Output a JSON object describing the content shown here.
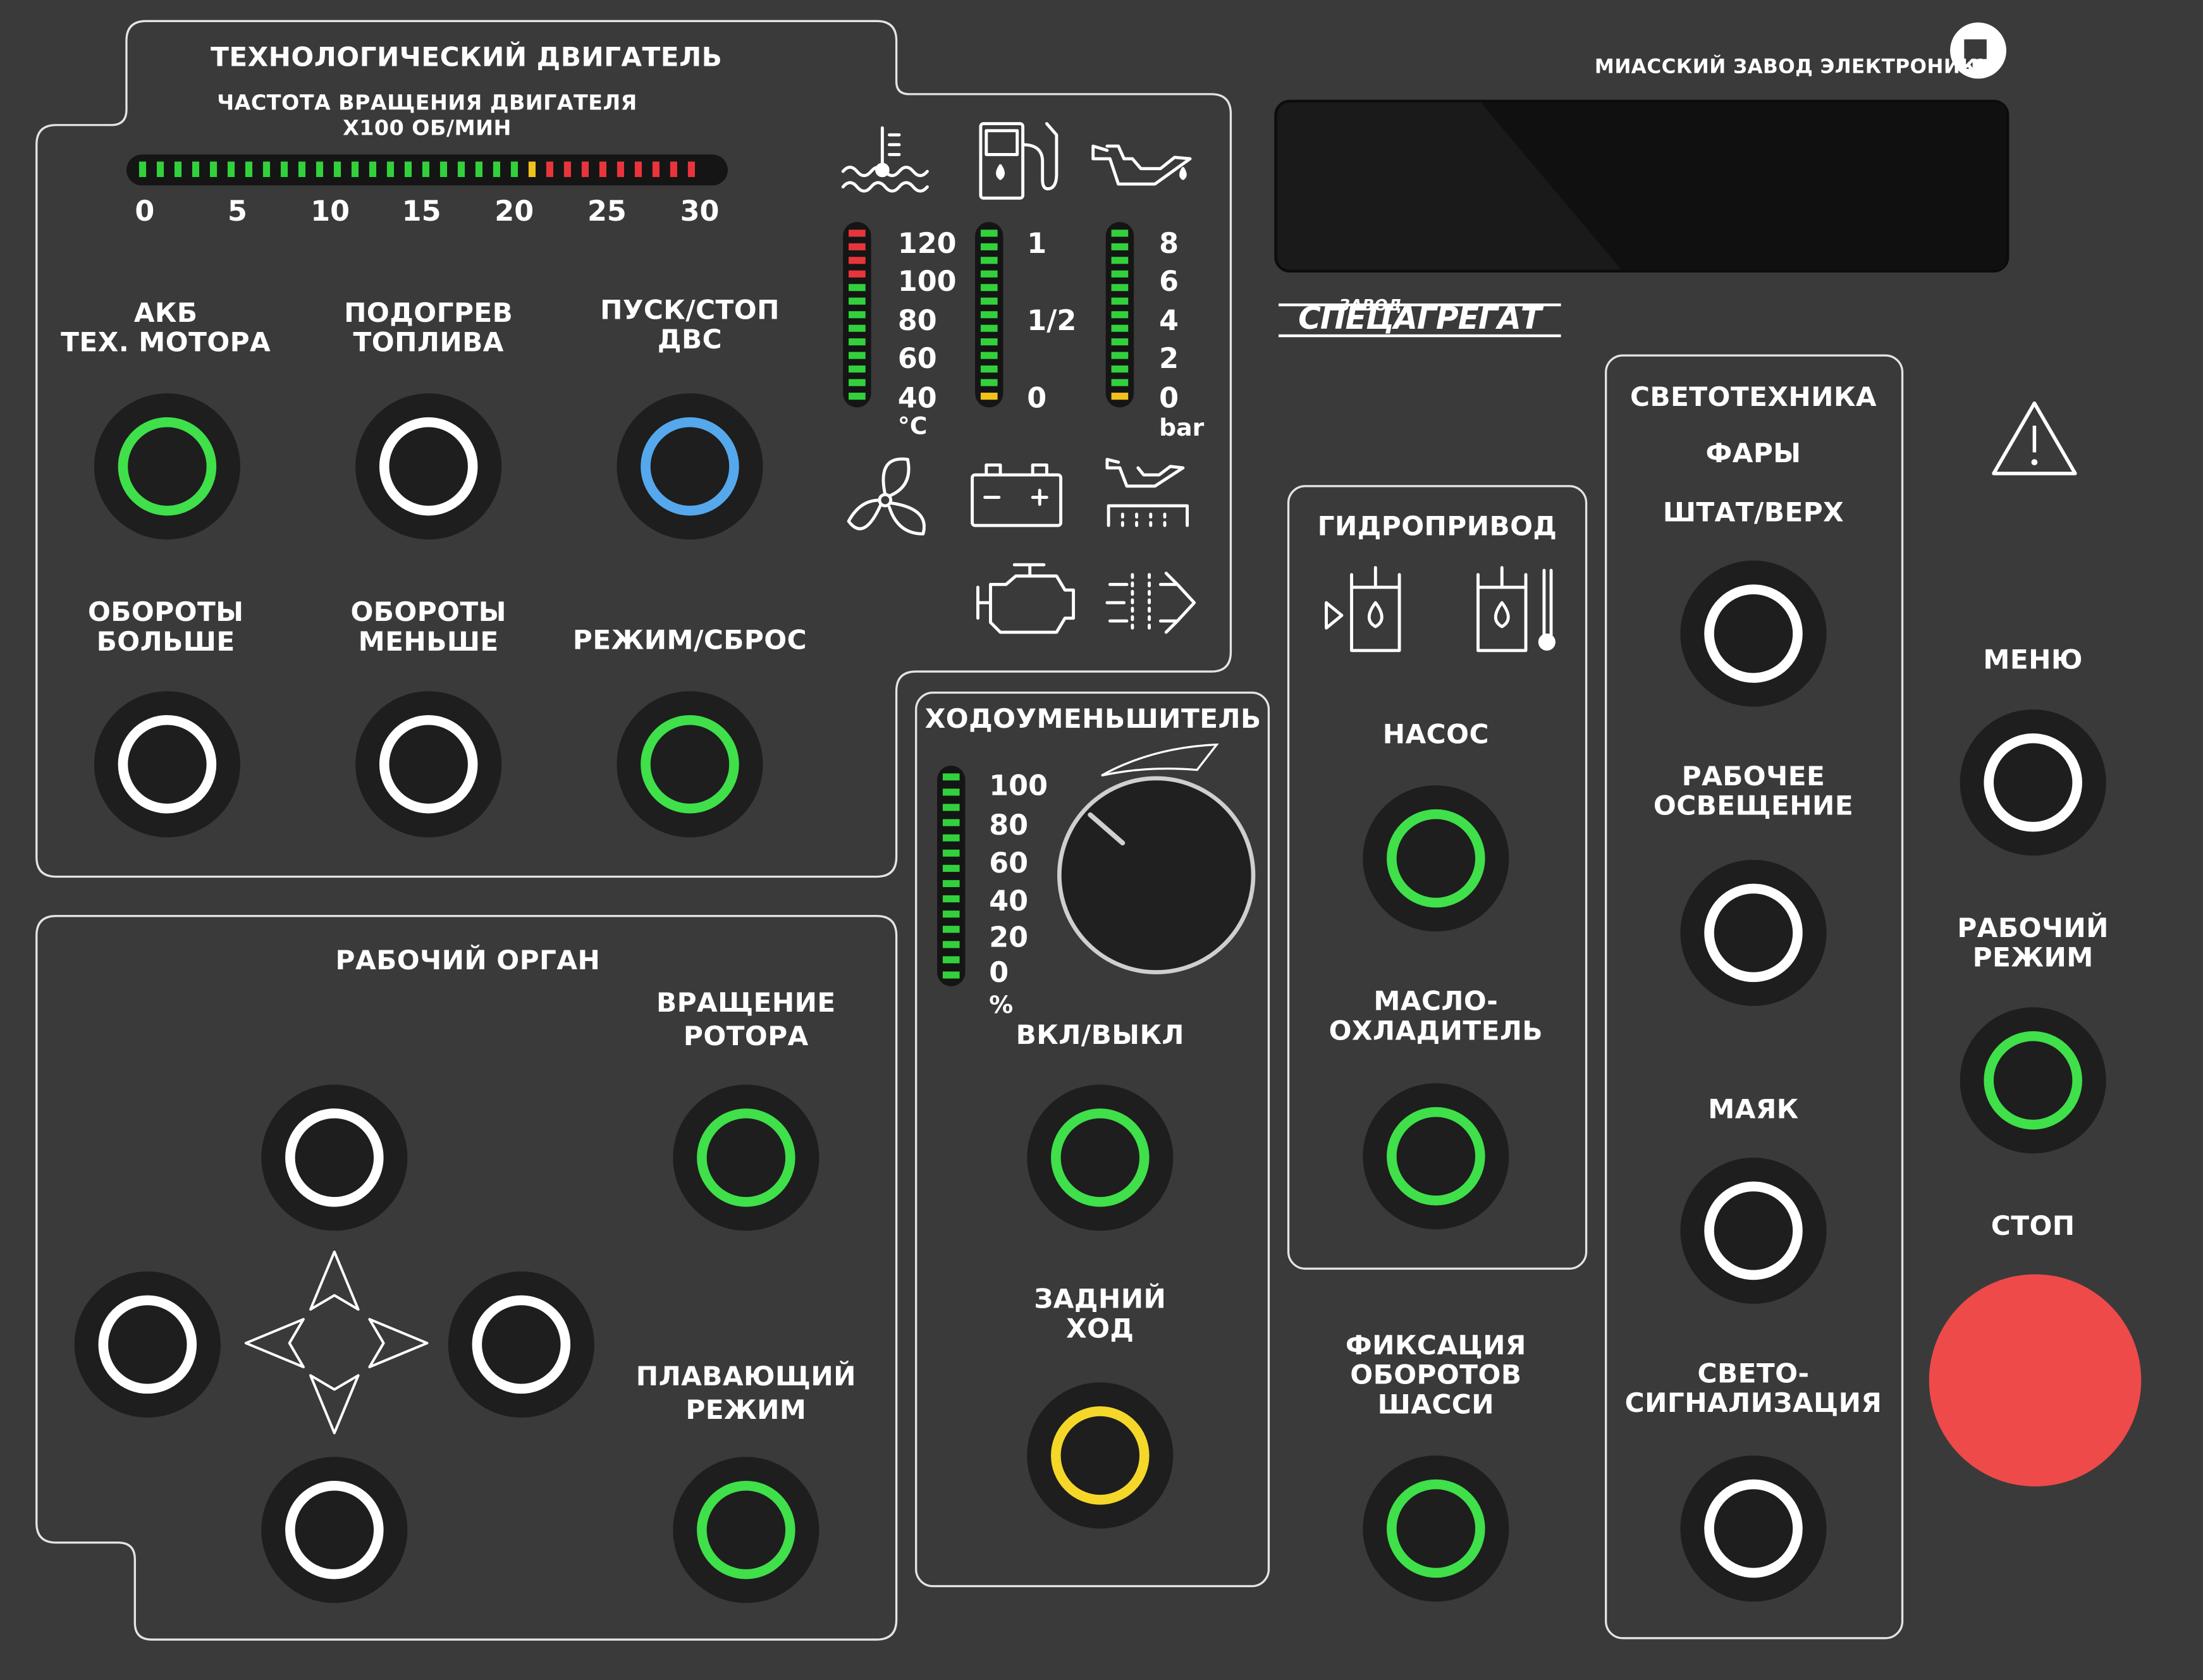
{
  "brand": {
    "company": "МИАССКИЙ ЗАВОД ЭЛЕКТРОНИКИ",
    "logo2_small": "ЗАВОД",
    "logo2_big": "СПЕЦАГРЕГАТ"
  },
  "colors": {
    "panel_bg": "#3a3a3a",
    "button_bg": "#1e1e1e",
    "green": "#3fe04a",
    "blue": "#55a8ec",
    "white": "#ffffff",
    "yellow": "#f5d72a",
    "red_stop": "#ee4a4a",
    "led_green": "#32d13c",
    "led_red": "#e8353b",
    "led_yellow": "#f1c21b"
  },
  "engine": {
    "title": "ТЕХНОЛОГИЧЕСКИЙ ДВИГАТЕЛЬ",
    "rpm_title": "ЧАСТОТА ВРАЩЕНИЯ ДВИГАТЕЛЯ",
    "rpm_unit": "Х100 ОБ/МИН",
    "rpm_ticks": [
      "0",
      "5",
      "10",
      "15",
      "20",
      "25",
      "30"
    ],
    "rpm_leds": {
      "green": 22,
      "yellow": 1,
      "red": 9
    },
    "buttons": [
      {
        "label1": "АКБ",
        "label2": "ТЕХ. МОТОРА",
        "ring": "green",
        "icon": "battery-icon"
      },
      {
        "label1": "ПОДОГРЕВ",
        "label2": "ТОПЛИВА",
        "ring": "white"
      },
      {
        "label1": "ПУСК/СТОП",
        "label2": "ДВС",
        "ring": "blue"
      },
      {
        "label1": "ОБОРОТЫ",
        "label2": "БОЛЬШЕ",
        "ring": "white"
      },
      {
        "label1": "ОБОРОТЫ",
        "label2": "МЕНЬШЕ",
        "ring": "white"
      },
      {
        "label1": "РЕЖИМ/СБРОС",
        "label2": "",
        "ring": "green"
      }
    ]
  },
  "gauges": {
    "coolant": {
      "ticks": [
        "120",
        "100",
        "80",
        "60",
        "40"
      ],
      "unit": "°C",
      "icon": "coolant-temperature-icon"
    },
    "fuel": {
      "ticks": [
        "1",
        "1/2",
        "0"
      ],
      "icon": "fuel-pump-icon"
    },
    "oil": {
      "ticks": [
        "8",
        "6",
        "4",
        "2",
        "0"
      ],
      "unit": "bar",
      "icon": "oil-can-icon"
    },
    "status_icons": [
      "fan-icon",
      "battery-icon",
      "oil-level-icon",
      "engine-icon",
      "air-filter-icon"
    ]
  },
  "work_organ": {
    "title": "РАБОЧИЙ ОРГАН",
    "rotor": {
      "label1": "ВРАЩЕНИЕ",
      "label2": "РОТОРА"
    },
    "floating": {
      "label1": "ПЛАВАЮЩИЙ",
      "label2": "РЕЖИМ"
    }
  },
  "reducer": {
    "title": "ХОДОУМЕНЬШИТЕЛЬ",
    "ticks": [
      "100",
      "80",
      "60",
      "40",
      "20",
      "0"
    ],
    "unit": "%",
    "onoff": "ВКЛ/ВЫКЛ",
    "reverse1": "ЗАДНИЙ",
    "reverse2": "ХОД"
  },
  "hydro": {
    "title": "ГИДРОПРИВОД",
    "pump": "НАСОС",
    "cooler1": "МАСЛО-",
    "cooler2": "ОХЛАДИТЕЛЬ"
  },
  "chassis": {
    "label1": "ФИКСАЦИЯ",
    "label2": "ОБОРОТОВ",
    "label3": "ШАССИ"
  },
  "lights": {
    "title": "СВЕТОТЕХНИКА",
    "sub1": "ФАРЫ",
    "sub2": "ШТАТ/ВЕРХ",
    "work1": "РАБОЧЕЕ",
    "work2": "ОСВЕЩЕНИЕ",
    "beacon": "МАЯК",
    "signal1": "СВЕТО-",
    "signal2": "СИГНАЛИЗАЦИЯ"
  },
  "right": {
    "menu": "МЕНЮ",
    "mode1": "РАБОЧИЙ",
    "mode2": "РЕЖИМ",
    "stop": "СТОП"
  }
}
